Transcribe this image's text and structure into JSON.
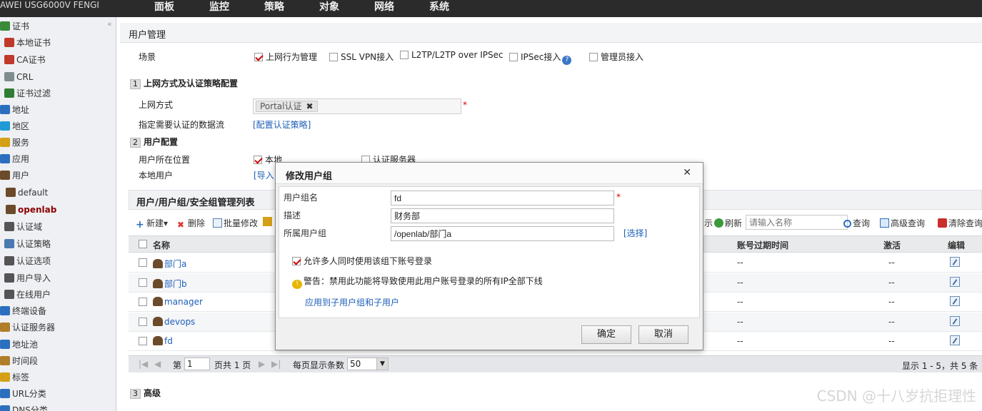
{
  "topbar": {
    "brand": "AWEI   USG6000V FENGI",
    "menu": [
      "面板",
      "监控",
      "策略",
      "对象",
      "网络",
      "系统"
    ]
  },
  "sidebar": {
    "collapse": "«",
    "items": [
      {
        "label": "证书",
        "icon": "certificate-icon",
        "color": "#3a8a3a"
      },
      {
        "label": "本地证书",
        "icon": "local-cert-icon",
        "color": "#c0392b"
      },
      {
        "label": "CA证书",
        "icon": "ca-cert-icon",
        "color": "#c0392b"
      },
      {
        "label": "CRL",
        "icon": "crl-icon",
        "color": "#7f8c8d"
      },
      {
        "label": "证书过滤",
        "icon": "cert-filter-icon",
        "color": "#2e7d32"
      },
      {
        "label": "地址",
        "icon": "address-icon",
        "color": "#2c6fbf"
      },
      {
        "label": "地区",
        "icon": "region-icon",
        "color": "#1f9ad6"
      },
      {
        "label": "服务",
        "icon": "service-icon",
        "color": "#d4a017"
      },
      {
        "label": "应用",
        "icon": "application-icon",
        "color": "#2c6fbf"
      },
      {
        "label": "用户",
        "icon": "user-icon",
        "color": "#6b4b2a"
      },
      {
        "label": "default",
        "icon": "user-icon",
        "color": "#6b4b2a"
      },
      {
        "label": "openlab",
        "icon": "user-icon",
        "color": "#6b4b2a"
      },
      {
        "label": "认证域",
        "icon": "auth-domain-icon",
        "color": "#555"
      },
      {
        "label": "认证策略",
        "icon": "auth-policy-icon",
        "color": "#4a78b0"
      },
      {
        "label": "认证选项",
        "icon": "auth-option-icon",
        "color": "#555"
      },
      {
        "label": "用户导入",
        "icon": "user-import-icon",
        "color": "#555"
      },
      {
        "label": "在线用户",
        "icon": "online-user-icon",
        "color": "#555"
      },
      {
        "label": "终端设备",
        "icon": "terminal-device-icon",
        "color": "#2c6fbf"
      },
      {
        "label": "认证服务器",
        "icon": "auth-server-icon",
        "color": "#b07d2a"
      },
      {
        "label": "地址池",
        "icon": "address-pool-icon",
        "color": "#2c6fbf"
      },
      {
        "label": "时间段",
        "icon": "time-range-icon",
        "color": "#b07d2a"
      },
      {
        "label": "标签",
        "icon": "tag-icon",
        "color": "#d4a017"
      },
      {
        "label": "URL分类",
        "icon": "url-category-icon",
        "color": "#2c6fbf"
      },
      {
        "label": "DNS分类",
        "icon": "dns-category-icon",
        "color": "#2c6fbf"
      }
    ]
  },
  "page": {
    "title": "用户管理",
    "scene_label": "场景",
    "scenes": [
      {
        "label": "上网行为管理",
        "checked": true
      },
      {
        "label": "SSL VPN接入",
        "checked": false
      },
      {
        "label": "L2TP/L2TP over IPSec",
        "checked": false
      },
      {
        "label": "IPSec接入",
        "checked": false
      },
      {
        "label": "管理员接入",
        "checked": false
      }
    ],
    "help": "?",
    "section1_num": "1",
    "section1_title": "上网方式及认证策略配置",
    "access_label": "上网方式",
    "access_token": "Portal认证",
    "token_remove": "✖",
    "required": "*",
    "flow_label": "指定需要认证的数据流",
    "flow_link": "[配置认证策略]",
    "section2_num": "2",
    "section2_title": "用户配置",
    "location_label": "用户所在位置",
    "location_local": "本地",
    "location_server": "认证服务器",
    "local_user_label": "本地用户",
    "import_link": "[导入",
    "list_title": "用户/用户组/安全组管理列表",
    "toolbar": {
      "new": "新建▾",
      "delete": "删除",
      "batch_edit": "批量修改",
      "display": "示",
      "refresh": "刷新",
      "search_placeholder": "请输入名称",
      "query": "查询",
      "advanced_query": "高级查询",
      "clear_query": "清除查询"
    },
    "columns": {
      "name": "名称",
      "expire": "账号过期时间",
      "active": "激活",
      "edit": "编辑"
    },
    "rows": [
      {
        "name": "部门a",
        "expire": "--",
        "active": "--"
      },
      {
        "name": "部门b",
        "expire": "--",
        "active": "--"
      },
      {
        "name": "manager",
        "expire": "--",
        "active": "--"
      },
      {
        "name": "devops",
        "expire": "--",
        "active": "--"
      },
      {
        "name": "fd",
        "expire": "--",
        "active": "--"
      }
    ],
    "pager": {
      "first": "|◀",
      "prev": "◀",
      "page_label": "第",
      "page_value": "1",
      "page_total": "页共 1 页",
      "next": "▶",
      "last": "▶|",
      "per_page_label": "每页显示条数",
      "per_page_value": "50",
      "summary": "显示 1 - 5，共 5 条"
    },
    "section3_num": "3",
    "section3_title": "高级"
  },
  "dialog": {
    "title": "修改用户组",
    "close": "✕",
    "name_label": "用户组名",
    "name_value": "fd",
    "desc_label": "描述",
    "desc_value": "财务部",
    "parent_label": "所属用户组",
    "parent_value": "/openlab/部门a",
    "select_link": "[选择]",
    "multi_login_label": "允许多人同时使用该组下账号登录",
    "multi_login_checked": true,
    "warning": "警告：禁用此功能将导致使用此用户账号登录的所有IP全部下线",
    "apply_link": "应用到子用户组和子用户",
    "ok": "确定",
    "cancel": "取消"
  },
  "watermark": "CSDN @十八岁抗拒理性"
}
